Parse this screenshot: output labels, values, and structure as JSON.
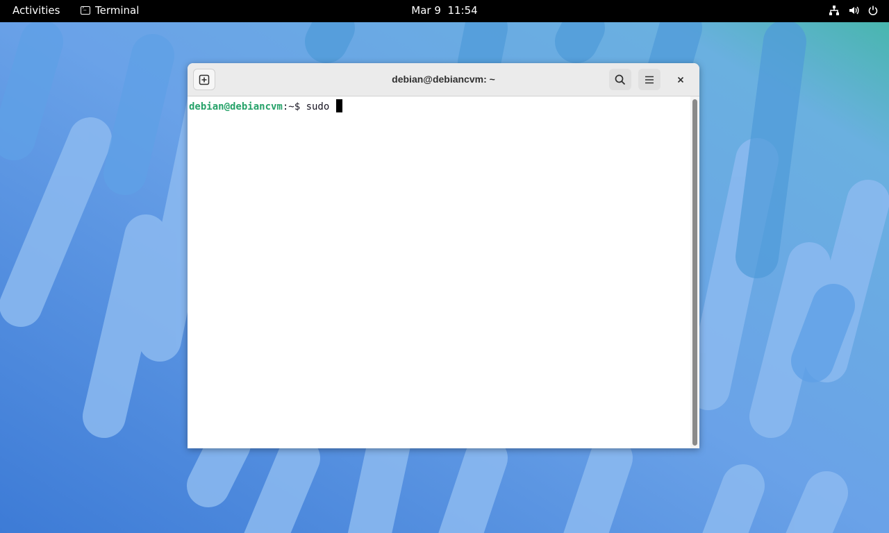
{
  "topbar": {
    "activities": "Activities",
    "app_name": "Terminal",
    "clock": "Mar 9  11:54",
    "status_icons": [
      "network-icon",
      "volume-icon",
      "power-icon"
    ]
  },
  "window": {
    "title": "debian@debiancvm: ~",
    "buttons": [
      "new-tab-icon",
      "search-icon",
      "hamburger-menu-icon",
      "close-icon"
    ]
  },
  "terminal": {
    "user_host": "debian@debiancvm",
    "path_sep": ":~$ ",
    "command": "sudo "
  },
  "colors": {
    "prompt_green": "#26a269",
    "topbar": "#000000",
    "wallpaper_base": "#5b93de"
  }
}
